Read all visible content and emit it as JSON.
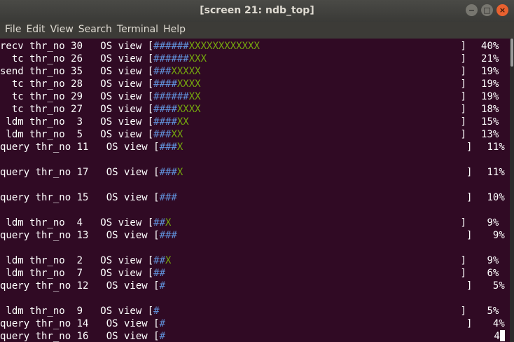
{
  "window": {
    "title": "[screen 21: ndb_top]",
    "menu": [
      "File",
      "Edit",
      "View",
      "Search",
      "Terminal",
      "Help"
    ]
  },
  "colors": {
    "background": "#300a24",
    "hash": "#5f8ed6",
    "x": "#75a80e",
    "text": "#ffffff"
  },
  "terminal": {
    "rows": [
      {
        "label": "recv thr_no 30   OS view [",
        "hashes": "######",
        "xs": "XXXXXXXXXXXX",
        "close": "]",
        "pct": "40%"
      },
      {
        "label": "  tc thr_no 26   OS view [",
        "hashes": "######",
        "xs": "XXX",
        "close": "]",
        "pct": "21%"
      },
      {
        "label": "send thr_no 35   OS view [",
        "hashes": "###",
        "xs": "XXXXX",
        "close": "]",
        "pct": "19%"
      },
      {
        "label": "  tc thr_no 28   OS view [",
        "hashes": "####",
        "xs": "XXXX",
        "close": "]",
        "pct": "19%"
      },
      {
        "label": "  tc thr_no 29   OS view [",
        "hashes": "######",
        "xs": "XX",
        "close": "]",
        "pct": "19%"
      },
      {
        "label": "  tc thr_no 27   OS view [",
        "hashes": "####",
        "xs": "XXXX",
        "close": "]",
        "pct": "18%"
      },
      {
        "label": " ldm thr_no  3   OS view [",
        "hashes": "####",
        "xs": "XX",
        "close": "]",
        "pct": "15%"
      },
      {
        "label": " ldm thr_no  5   OS view [",
        "hashes": "###",
        "xs": "XX",
        "close": "]",
        "pct": "13%"
      },
      {
        "label": "query thr_no 11   OS view [",
        "hashes": "###",
        "xs": "X",
        "close": "]",
        "pct": "11%"
      },
      {
        "label": "query thr_no 17   OS view [",
        "hashes": "###",
        "xs": "X",
        "close": "]",
        "pct": "11%"
      },
      {
        "label": "query thr_no 15   OS view [",
        "hashes": "###",
        "xs": "",
        "close": "]",
        "pct": "10%"
      },
      {
        "label": " ldm thr_no  4   OS view [",
        "hashes": "##",
        "xs": "X",
        "close": "]",
        "pct": "9%"
      },
      {
        "label": "query thr_no 13   OS view [",
        "hashes": "###",
        "xs": "",
        "close": "]",
        "pct": "9%"
      },
      {
        "label": " ldm thr_no  2   OS view [",
        "hashes": "##",
        "xs": "X",
        "close": "]",
        "pct": "9%"
      },
      {
        "label": " ldm thr_no  7   OS view [",
        "hashes": "##",
        "xs": "",
        "close": "]",
        "pct": "6%"
      },
      {
        "label": "query thr_no 12   OS view [",
        "hashes": "#",
        "xs": "",
        "close": "]",
        "pct": "5%"
      },
      {
        "label": " ldm thr_no  9   OS view [",
        "hashes": "#",
        "xs": "",
        "close": "]",
        "pct": "5%"
      },
      {
        "label": "query thr_no 14   OS view [",
        "hashes": "#",
        "xs": "",
        "close": "]",
        "pct": "4%"
      },
      {
        "label": "query thr_no 16   OS view [",
        "hashes": "#",
        "xs": "",
        "close": "",
        "pct": "4"
      }
    ]
  }
}
